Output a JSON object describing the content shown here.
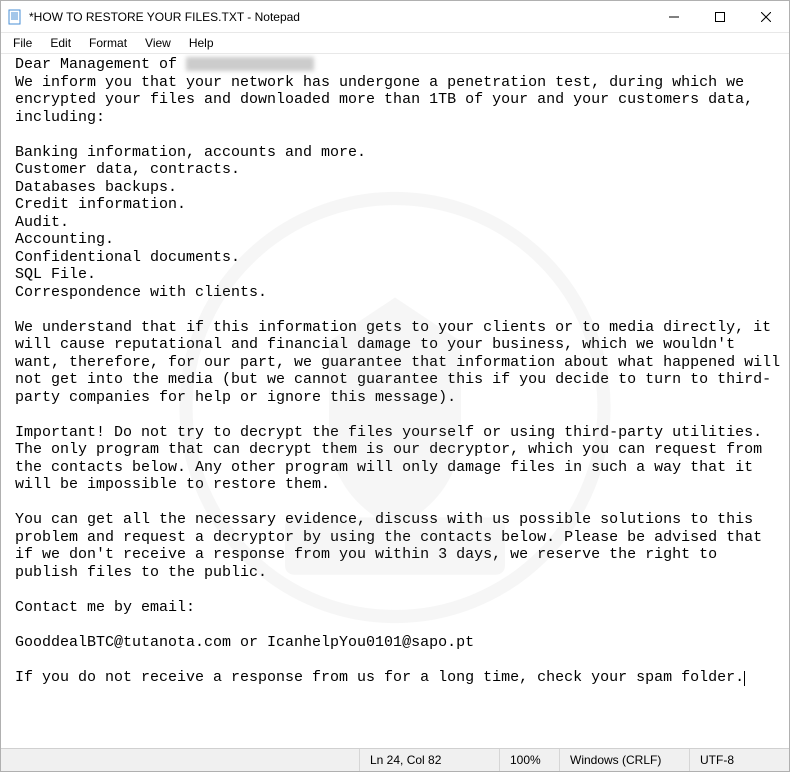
{
  "window": {
    "title": "*HOW TO RESTORE YOUR FILES.TXT - Notepad"
  },
  "menu": {
    "file": "File",
    "edit": "Edit",
    "format": "Format",
    "view": "View",
    "help": "Help"
  },
  "body": {
    "greeting_prefix": "Dear Management of ",
    "p1": "We inform you that your network has undergone a penetration test, during which we encrypted your files and downloaded more than 1TB of your and your customers data, including:",
    "list1": "Banking information, accounts and more.",
    "list2": "Customer data, contracts.",
    "list3": "Databases backups.",
    "list4": "Credit information.",
    "list5": "Audit.",
    "list6": "Accounting.",
    "list7": "Confidentional documents.",
    "list8": "SQL File.",
    "list9": "Correspondence with clients.",
    "p2": "We understand that if this information gets to your clients or to media directly, it will cause reputational and financial damage to your business, which we wouldn't want, therefore, for our part, we guarantee that information about what happened will not get into the media (but we cannot guarantee this if you decide to turn to third-party companies for help or ignore this message).",
    "p3": "Important! Do not try to decrypt the files yourself or using third-party utilities. The only program that can decrypt them is our decryptor, which you can request from the contacts below. Any other program will only damage files in such a way that it will be impossible to restore them.",
    "p4": "You can get all the necessary evidence, discuss with us possible solutions to this problem and request a decryptor by using the contacts below. Please be advised that if we don't receive a response from you within 3 days, we reserve the right to publish files to the public.",
    "p5": "Contact me by email:",
    "p6": "GooddealBTC@tutanota.com or IcanhelpYou0101@sapo.pt",
    "p7": "If you do not receive a response from us for a long time, check your spam folder."
  },
  "status": {
    "position": "Ln 24, Col 82",
    "zoom": "100%",
    "line_ending": "Windows (CRLF)",
    "encoding": "UTF-8"
  }
}
